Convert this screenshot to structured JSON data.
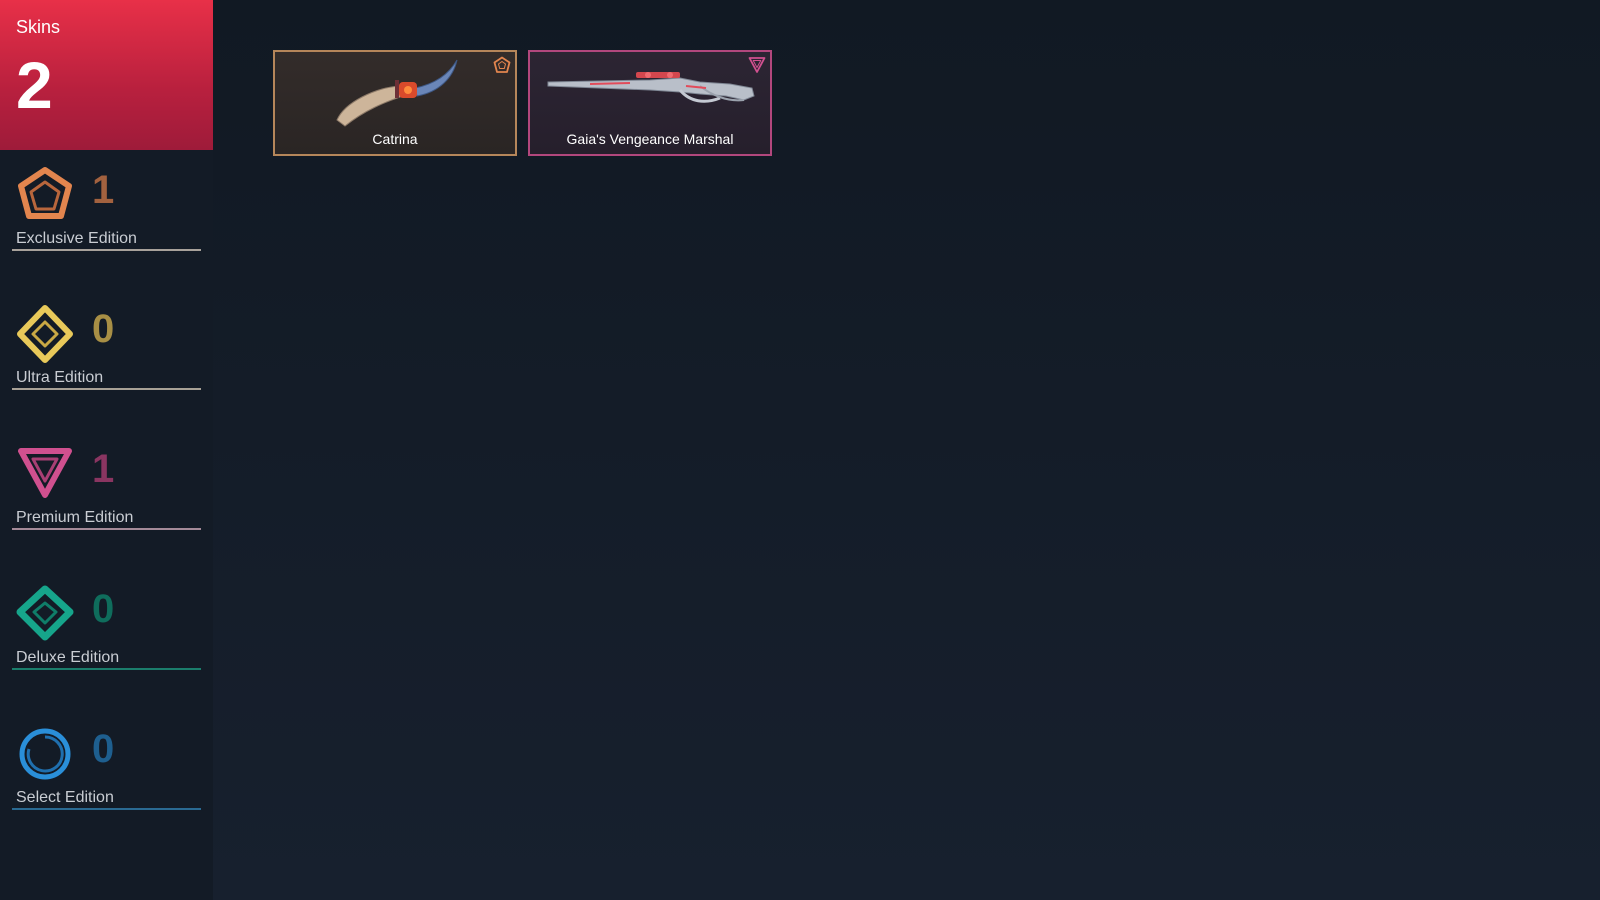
{
  "skins": {
    "title": "Skins",
    "count": "2"
  },
  "editions": [
    {
      "label": "Exclusive Edition",
      "count": "1",
      "icon": "exclusive-edition-icon",
      "color": "#e2854e",
      "count_color": "#a3623f"
    },
    {
      "label": "Ultra Edition",
      "count": "0",
      "icon": "ultra-edition-icon",
      "color": "#e8c95a",
      "count_color": "#a88f45"
    },
    {
      "label": "Premium Edition",
      "count": "1",
      "icon": "premium-edition-icon",
      "color": "#d0508f",
      "count_color": "#8a3561"
    },
    {
      "label": "Deluxe Edition",
      "count": "0",
      "icon": "deluxe-edition-icon",
      "color": "#16a58b",
      "count_color": "#0f6d5c"
    },
    {
      "label": "Select Edition",
      "count": "0",
      "icon": "select-edition-icon",
      "color": "#2a8fd9",
      "count_color": "#1e5f8f"
    }
  ],
  "cards": [
    {
      "name": "Catrina",
      "rarity": "exclusive-edition-icon",
      "border": "#b5865a"
    },
    {
      "name": "Gaia's Vengeance Marshal",
      "rarity": "premium-edition-icon",
      "border": "#b2477d"
    }
  ]
}
